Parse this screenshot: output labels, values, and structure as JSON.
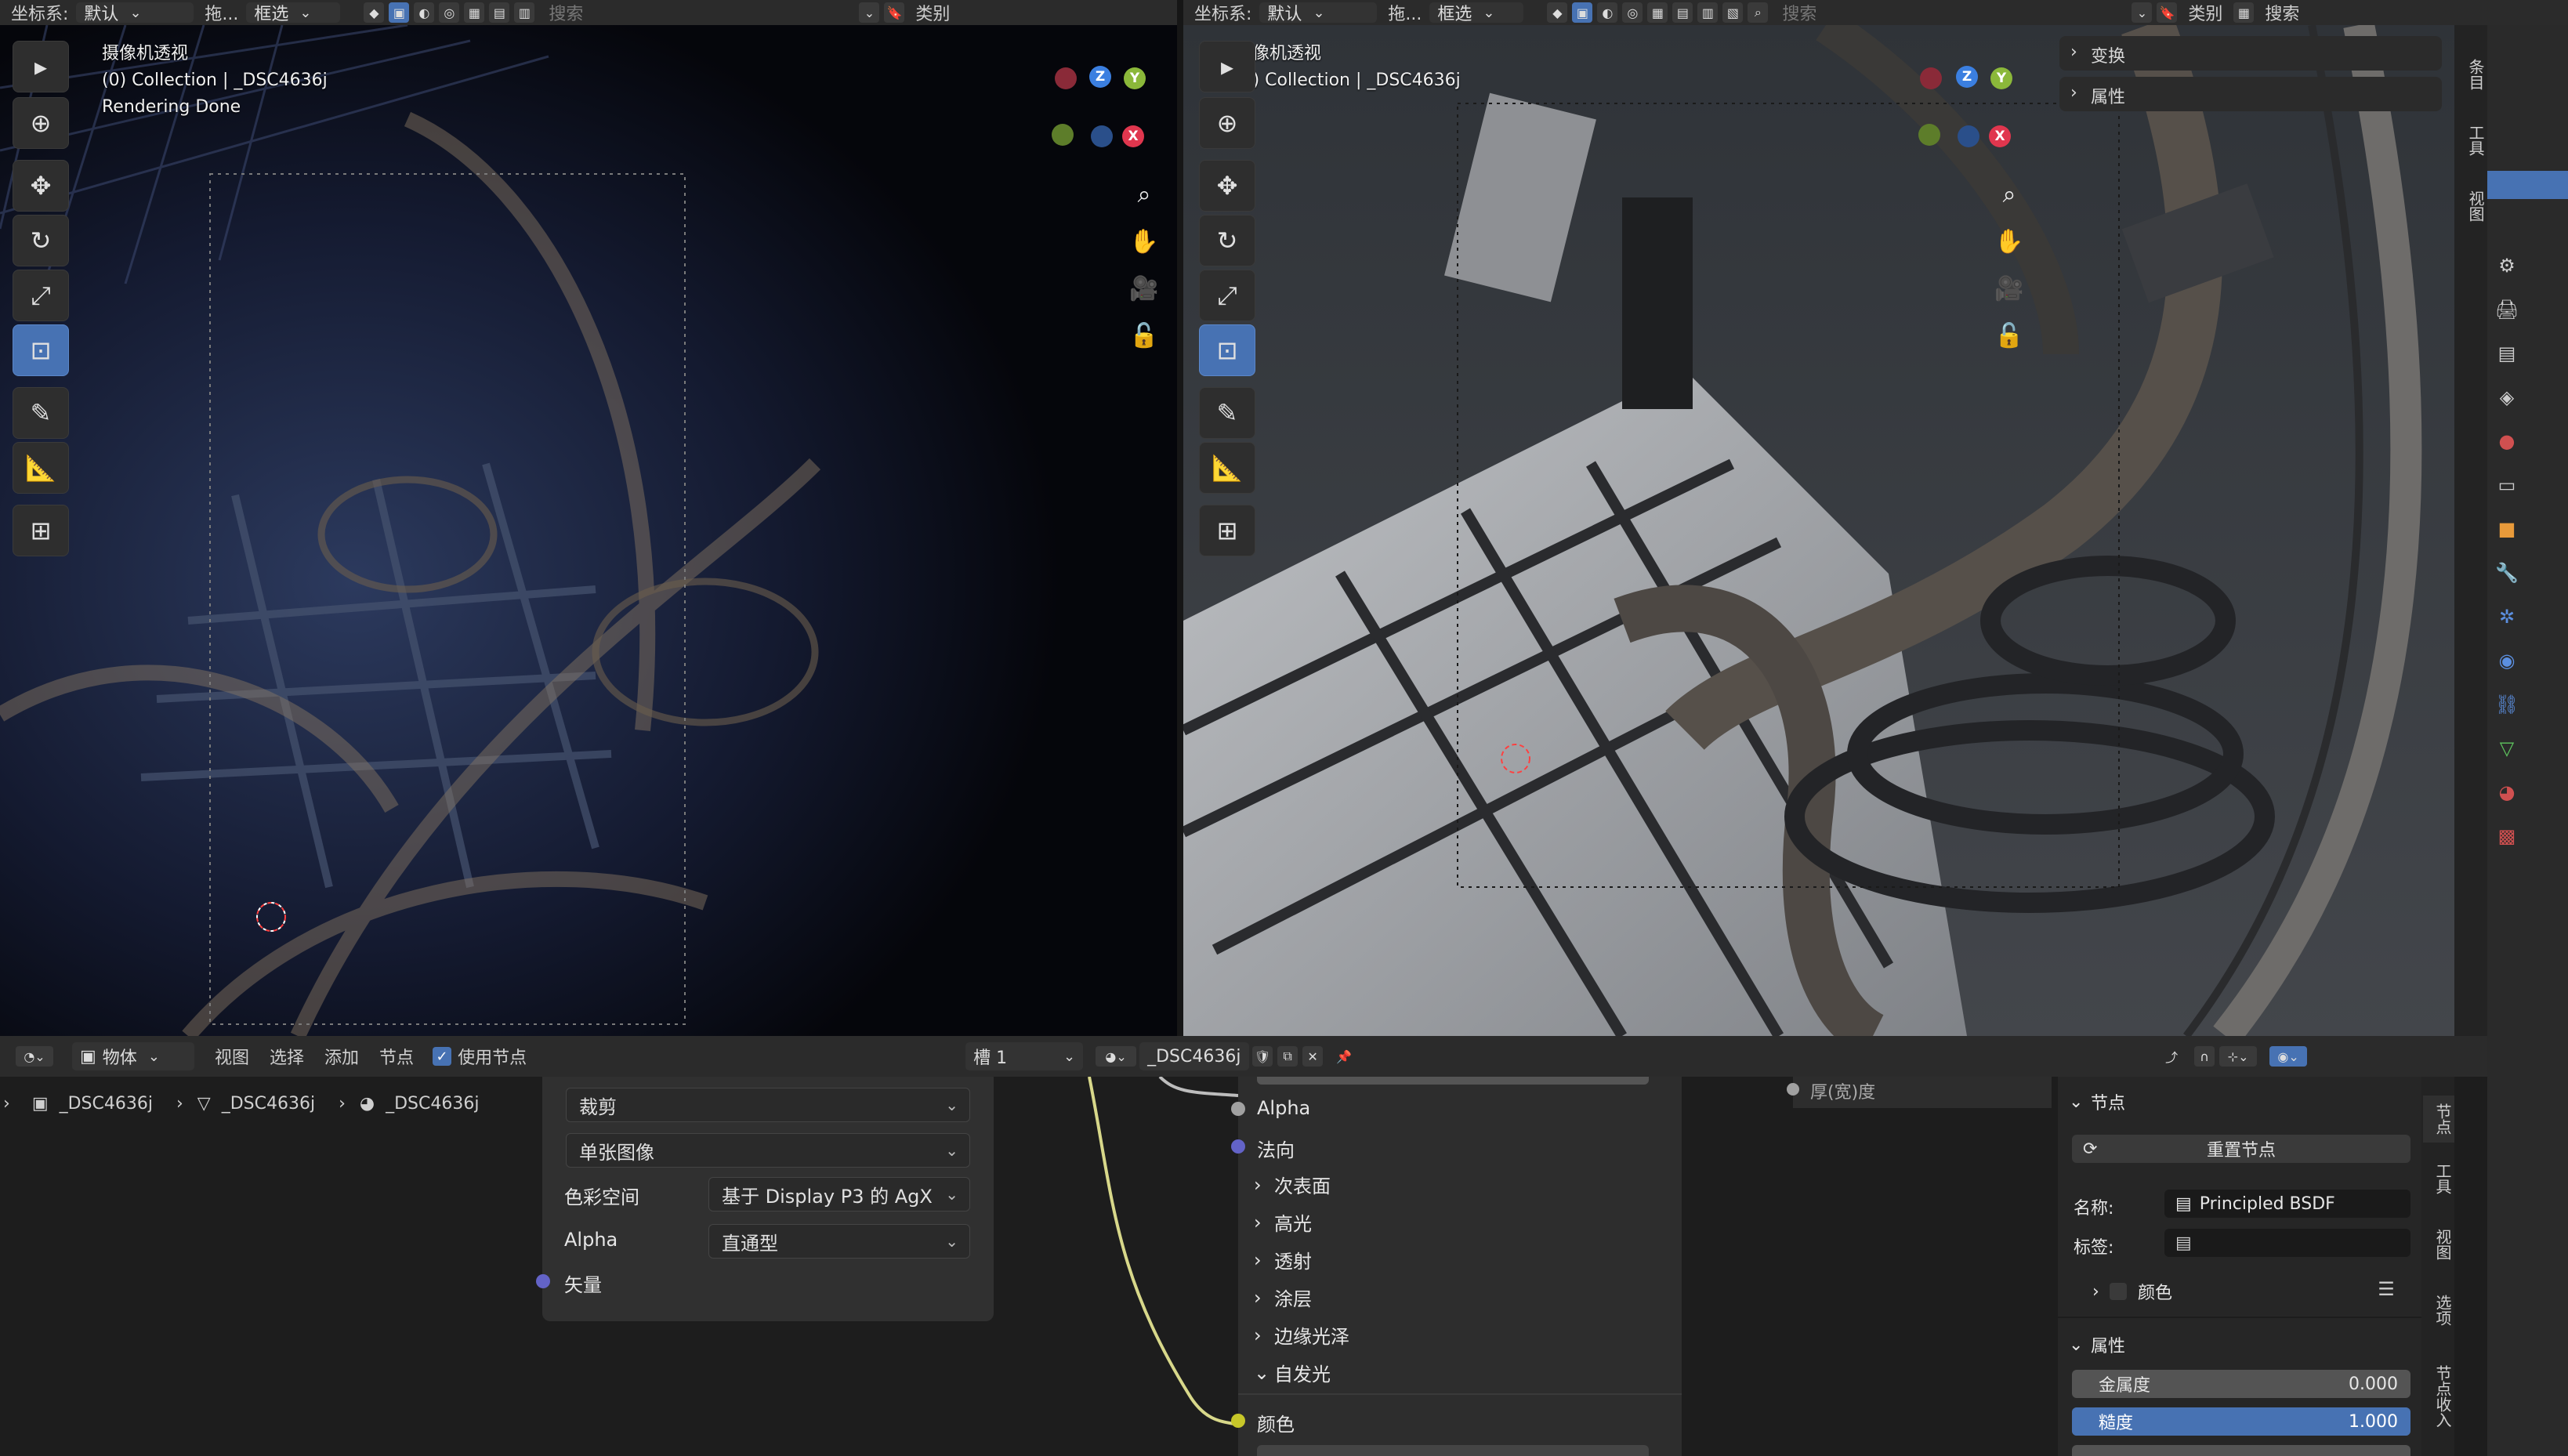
{
  "left_header": {
    "coord_label": "坐标系:",
    "coord_value": "默认",
    "drag_label": "拖...",
    "select_mode": "框选",
    "search_placeholder": "搜索",
    "category": "类别"
  },
  "right_header": {
    "coord_label": "坐标系:",
    "coord_value": "默认",
    "drag_label": "拖...",
    "select_mode": "框选",
    "search_placeholder": "搜索",
    "category": "类别",
    "search2": "搜索"
  },
  "left_viewport": {
    "title": "摄像机透视",
    "collection": "(0) Collection | _DSC4636j",
    "status": "Rendering Done"
  },
  "right_viewport": {
    "title": "摄像机透视",
    "collection": "(0) Collection | _DSC4636j"
  },
  "gizmo": {
    "x": "X",
    "y": "Y",
    "z": "Z",
    "x_color": "#e0364e",
    "y_color": "#8bb83a",
    "z_color": "#3b7fe0"
  },
  "npanel": {
    "transform": "变换",
    "properties": "属性"
  },
  "right_sidebar_tabs": [
    "条目",
    "工具",
    "视图"
  ],
  "node_header": {
    "object_mode": "物体",
    "menu": [
      "视图",
      "选择",
      "添加",
      "节点"
    ],
    "use_nodes": "使用节点",
    "slot": "槽 1",
    "material": "_DSC4636j"
  },
  "breadcrumb": [
    "_DSC4636j",
    "_DSC4636j",
    "_DSC4636j"
  ],
  "image_node": {
    "crop": "裁剪",
    "single_image": "单张图像",
    "colorspace_label": "色彩空间",
    "colorspace_value": "基于 Display P3 的 AgX",
    "alpha_label": "Alpha",
    "alpha_value": "直通型",
    "vector": "矢量"
  },
  "bsdf_node": {
    "alpha": "Alpha",
    "normal": "法向",
    "subsurface": "次表面",
    "specular": "高光",
    "transmission": "透射",
    "coat": "涂层",
    "sheen": "边缘光泽",
    "emission": "自发光",
    "color": "颜色",
    "thickness": "厚(宽)度"
  },
  "node_panel": {
    "section_node": "节点",
    "reset": "重置节点",
    "name_label": "名称:",
    "name_value": "Principled BSDF",
    "tag_label": "标签:",
    "color": "颜色",
    "section_props": "属性",
    "metallic_label": "金属度",
    "metallic_value": "0.000",
    "roughness_label": "糙度",
    "roughness_value": "1.000",
    "roughness_fill": 1.0,
    "metallic_fill": 0.0
  },
  "node_sidebar_tabs": [
    "节点",
    "工具",
    "视图",
    "选项",
    "节点收入"
  ],
  "colors": {
    "accent": "#4772b3",
    "socket_yellow": "#c7c729",
    "socket_grey": "#a1a1a1",
    "socket_purple": "#6363c7",
    "link_yellow": "#d8d88a"
  }
}
